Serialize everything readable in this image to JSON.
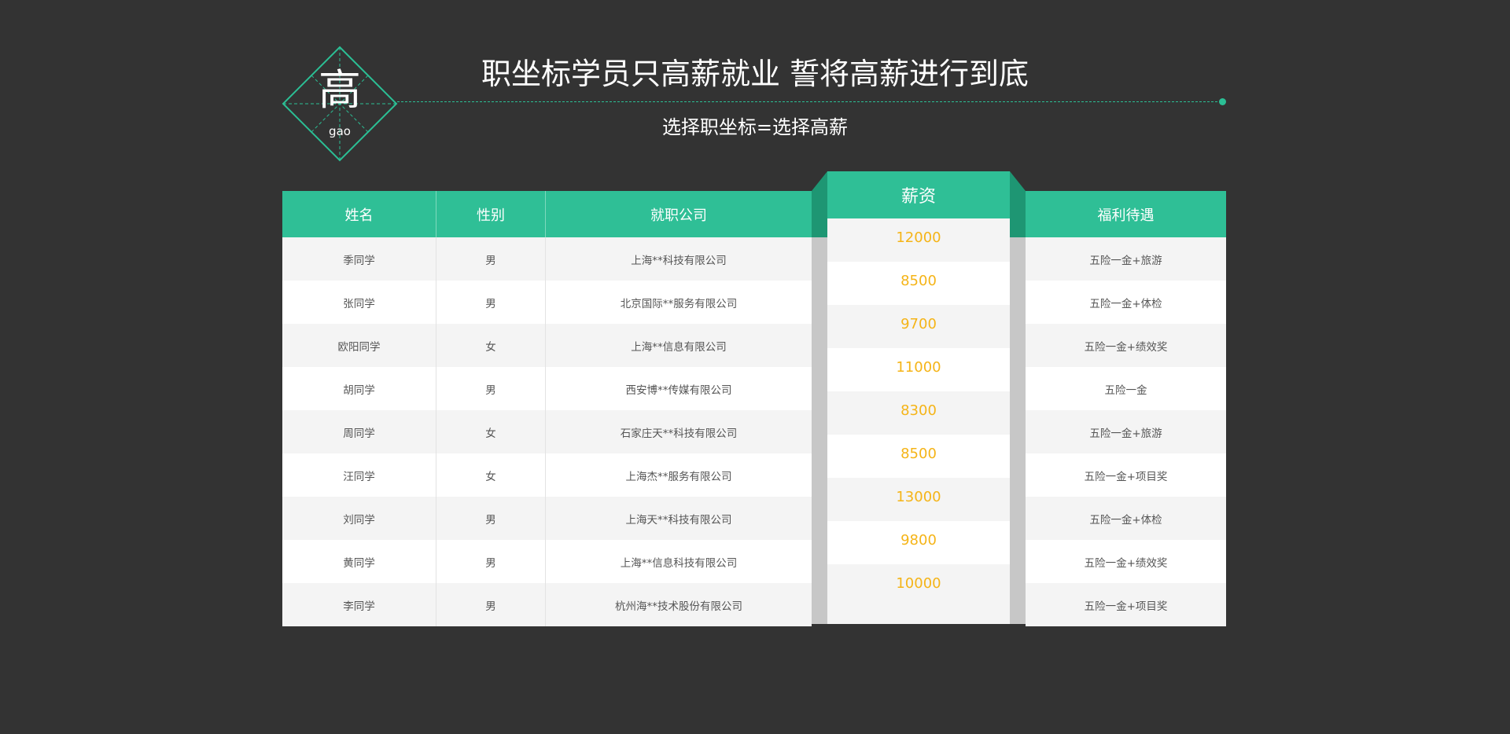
{
  "logo": {
    "char": "高",
    "pinyin": "gao"
  },
  "header": {
    "title": "职坐标学员只高薪就业 誓将高薪进行到底",
    "subtitle": "选择职坐标=选择高薪"
  },
  "table": {
    "headers": {
      "name": "姓名",
      "gender": "性别",
      "company": "就职公司",
      "salary": "薪资",
      "benefits": "福利待遇"
    },
    "rows": [
      {
        "name": "季同学",
        "gender": "男",
        "company": "上海**科技有限公司",
        "salary": "12000",
        "benefits": "五险一金+旅游"
      },
      {
        "name": "张同学",
        "gender": "男",
        "company": "北京国际**服务有限公司",
        "salary": "8500",
        "benefits": "五险一金+体检"
      },
      {
        "name": "欧阳同学",
        "gender": "女",
        "company": "上海**信息有限公司",
        "salary": "9700",
        "benefits": "五险一金+绩效奖"
      },
      {
        "name": "胡同学",
        "gender": "男",
        "company": "西安博**传媒有限公司",
        "salary": "11000",
        "benefits": "五险一金"
      },
      {
        "name": "周同学",
        "gender": "女",
        "company": "石家庄天**科技有限公司",
        "salary": "8300",
        "benefits": "五险一金+旅游"
      },
      {
        "name": "汪同学",
        "gender": "女",
        "company": "上海杰**服务有限公司",
        "salary": "8500",
        "benefits": "五险一金+项目奖"
      },
      {
        "name": "刘同学",
        "gender": "男",
        "company": "上海天**科技有限公司",
        "salary": "13000",
        "benefits": "五险一金+体检"
      },
      {
        "name": "黄同学",
        "gender": "男",
        "company": "上海**信息科技有限公司",
        "salary": "9800",
        "benefits": "五险一金+绩效奖"
      },
      {
        "name": "李同学",
        "gender": "男",
        "company": "杭州海**技术股份有限公司",
        "salary": "10000",
        "benefits": "五险一金+项目奖"
      }
    ]
  },
  "colors": {
    "accent": "#2fbf96",
    "accent_dark": "#1e9673",
    "salary_text": "#f5b417",
    "background": "#333333"
  }
}
